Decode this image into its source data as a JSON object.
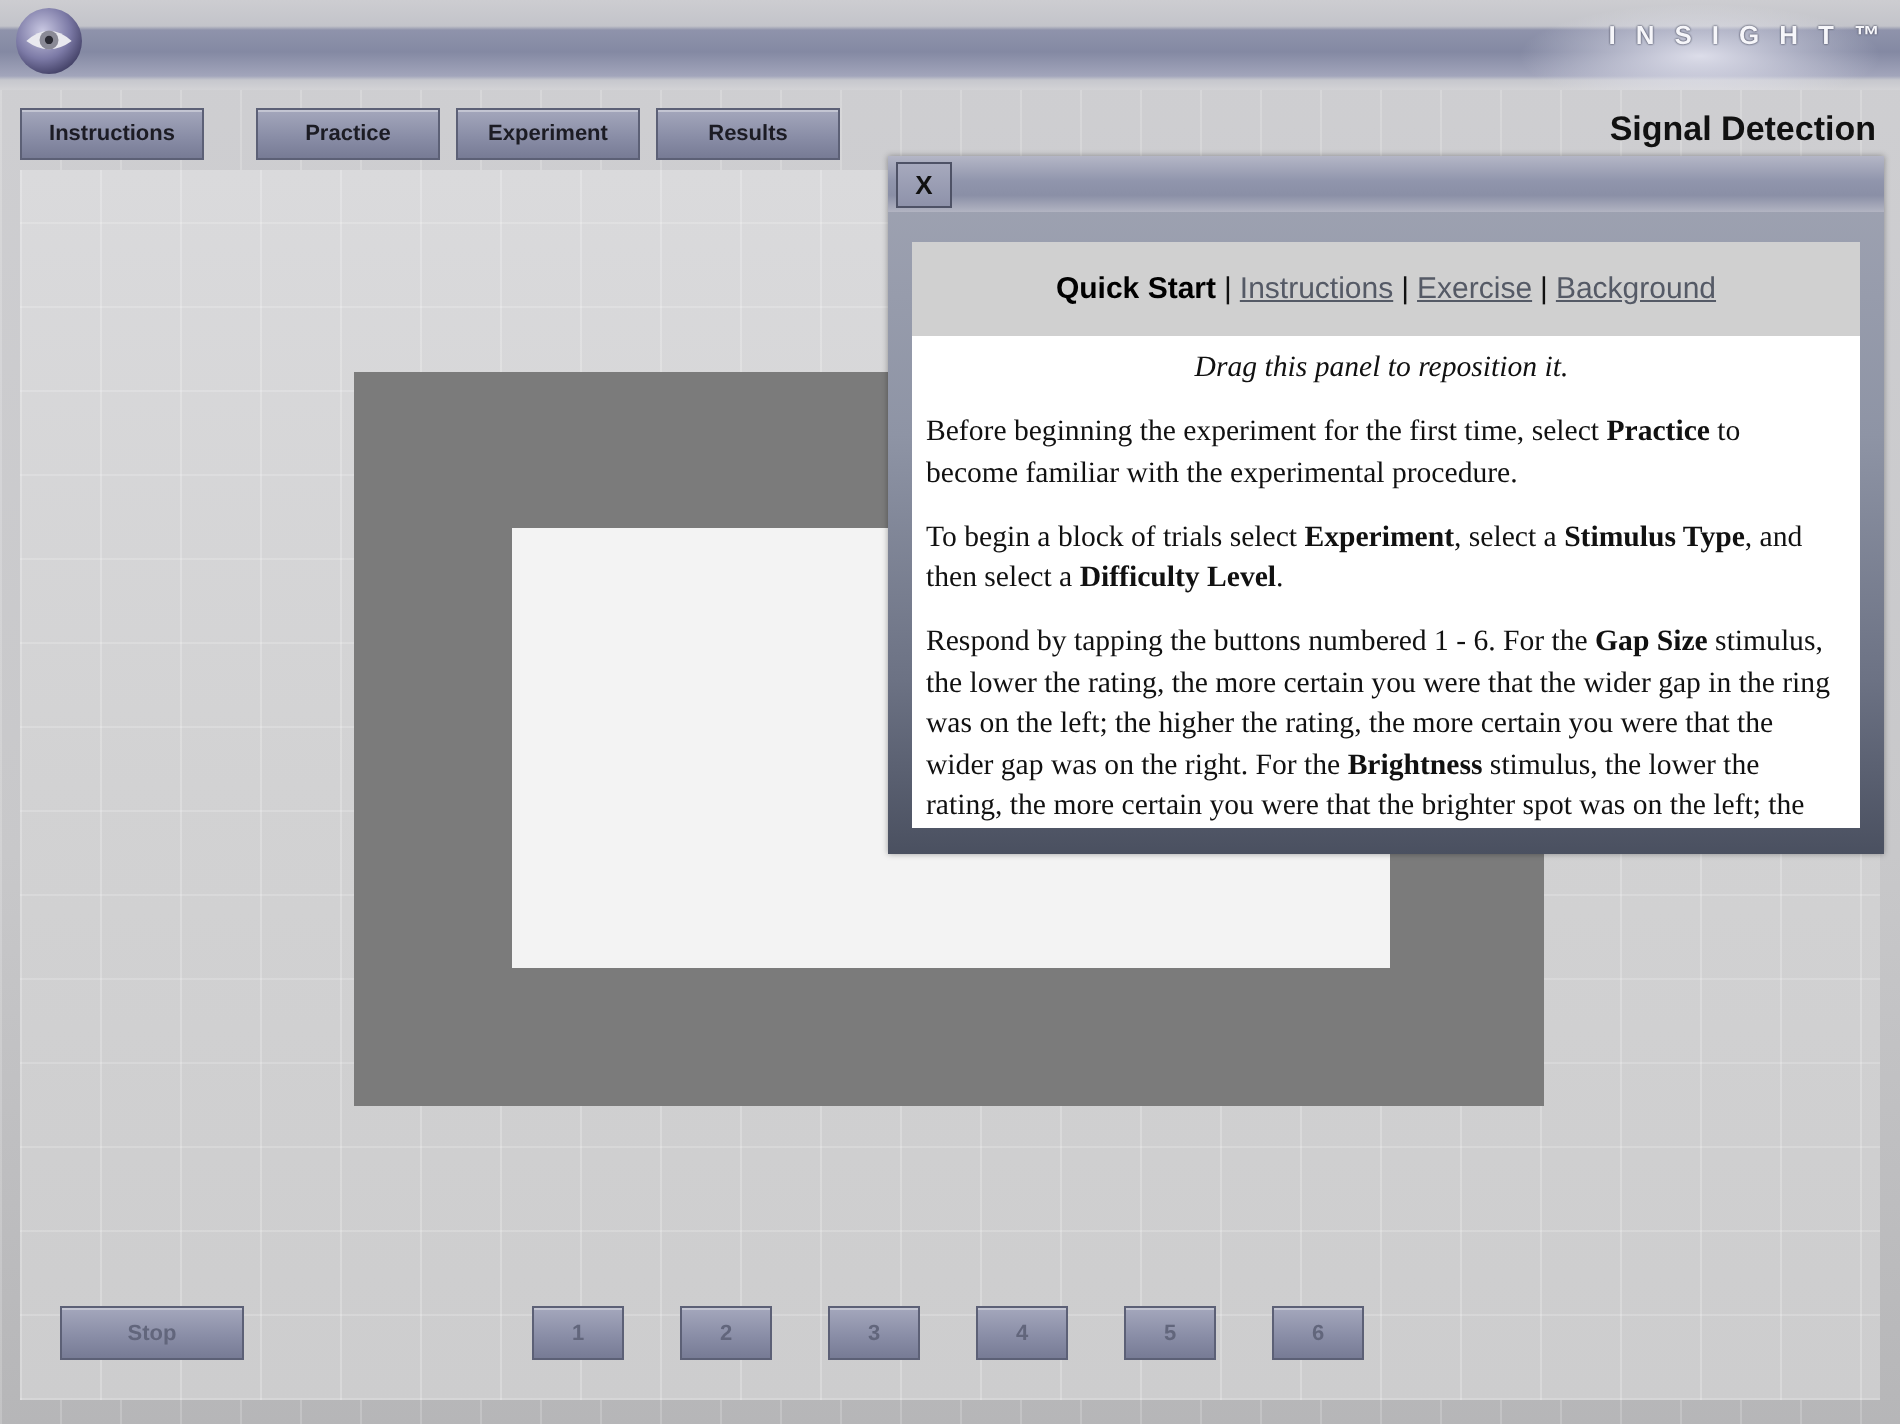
{
  "header": {
    "logo": "INSIGHT™"
  },
  "nav": {
    "buttons": [
      "Instructions",
      "Practice",
      "Experiment",
      "Results"
    ],
    "title": "Signal Detection"
  },
  "controls": {
    "stop": {
      "label": "Stop",
      "disabled": true
    },
    "ratings": [
      {
        "label": "1",
        "disabled": true
      },
      {
        "label": "2",
        "disabled": true
      },
      {
        "label": "3",
        "disabled": true
      },
      {
        "label": "4",
        "disabled": true
      },
      {
        "label": "5",
        "disabled": true
      },
      {
        "label": "6",
        "disabled": true
      }
    ]
  },
  "panel": {
    "close": "X",
    "tabs": [
      {
        "label": "Quick Start",
        "selected": true
      },
      {
        "label": "Instructions",
        "selected": false,
        "separator": "|"
      },
      {
        "label": "Exercise",
        "selected": false,
        "separator": "|"
      },
      {
        "label": "Background",
        "selected": false,
        "separator": "|"
      }
    ],
    "hint": "Drag this panel to reposition it.",
    "paragraphs": [
      "Before beginning the experiment for the first time, select **Practice** to become familiar with the experimental procedure.",
      "To begin a block of trials select **Experiment**, select a **Stimulus Type**, and then select a **Difficulty Level**.",
      "Respond by tapping the buttons numbered 1 - 6. For the **Gap Size** stimulus, the lower the rating, the more certain you were that the wider gap in the ring was on the left; the higher the rating, the more certain you were that the wider gap was on the right. For the **Brightness** stimulus, the lower the rating, the more certain you were that the brighter spot was on the left; the"
    ]
  }
}
